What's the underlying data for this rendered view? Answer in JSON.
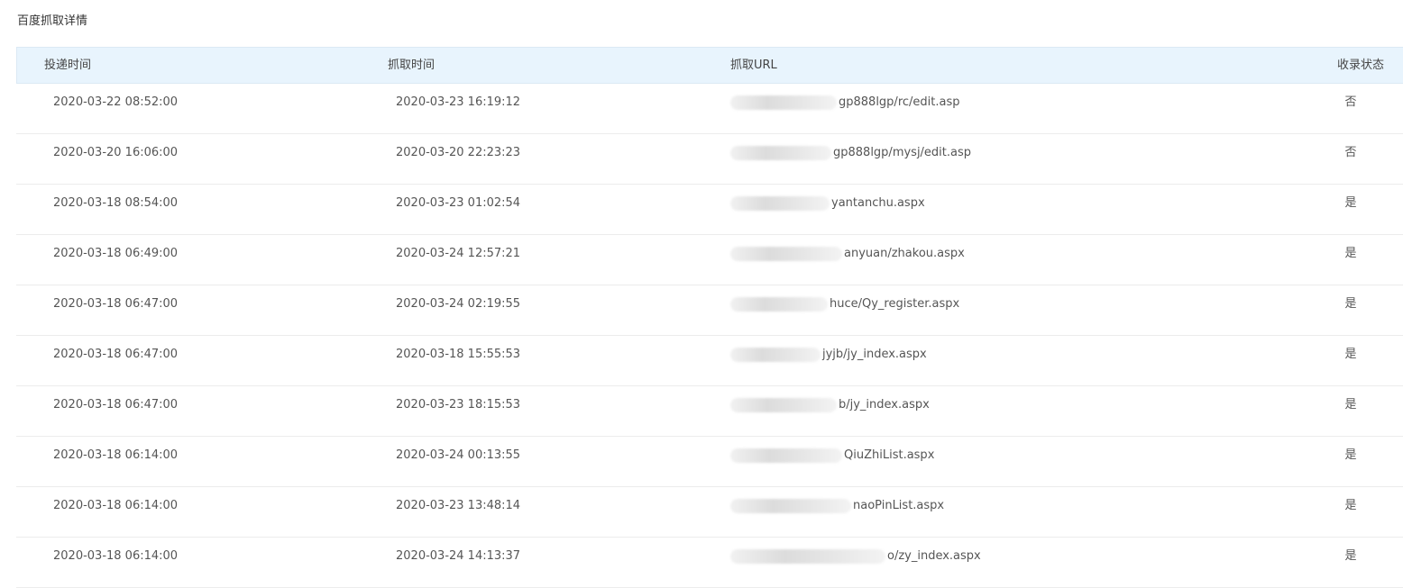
{
  "title": "百度抓取详情",
  "table": {
    "headers": {
      "submit_time": "投递时间",
      "crawl_time": "抓取时间",
      "crawl_url": "抓取URL",
      "index_status": "收录状态"
    },
    "rows": [
      {
        "submit_time": "2020-03-22 08:52:00",
        "crawl_time": "2020-03-23 16:19:12",
        "url_visible": "gp888lgp/rc/edit.asp",
        "status": "否"
      },
      {
        "submit_time": "2020-03-20 16:06:00",
        "crawl_time": "2020-03-20 22:23:23",
        "url_visible": "gp888lgp/mysj/edit.asp",
        "status": "否"
      },
      {
        "submit_time": "2020-03-18 08:54:00",
        "crawl_time": "2020-03-23 01:02:54",
        "url_visible": "yantanchu.aspx",
        "status": "是"
      },
      {
        "submit_time": "2020-03-18 06:49:00",
        "crawl_time": "2020-03-24 12:57:21",
        "url_visible": "anyuan/zhakou.aspx",
        "status": "是"
      },
      {
        "submit_time": "2020-03-18 06:47:00",
        "crawl_time": "2020-03-24 02:19:55",
        "url_visible": "huce/Qy_register.aspx",
        "status": "是"
      },
      {
        "submit_time": "2020-03-18 06:47:00",
        "crawl_time": "2020-03-18 15:55:53",
        "url_visible": "jyjb/jy_index.aspx",
        "status": "是"
      },
      {
        "submit_time": "2020-03-18 06:47:00",
        "crawl_time": "2020-03-23 18:15:53",
        "url_visible": "b/jy_index.aspx",
        "status": "是"
      },
      {
        "submit_time": "2020-03-18 06:14:00",
        "crawl_time": "2020-03-24 00:13:55",
        "url_visible": "QiuZhiList.aspx",
        "status": "是"
      },
      {
        "submit_time": "2020-03-18 06:14:00",
        "crawl_time": "2020-03-23 13:48:14",
        "url_visible": "naoPinList.aspx",
        "status": "是"
      },
      {
        "submit_time": "2020-03-18 06:14:00",
        "crawl_time": "2020-03-24 14:13:37",
        "url_visible": "o/zy_index.aspx",
        "status": "是"
      }
    ]
  },
  "colors": {
    "header_bg": "#e8f4fd",
    "row_divider": "#ececec",
    "text": "#555555"
  }
}
